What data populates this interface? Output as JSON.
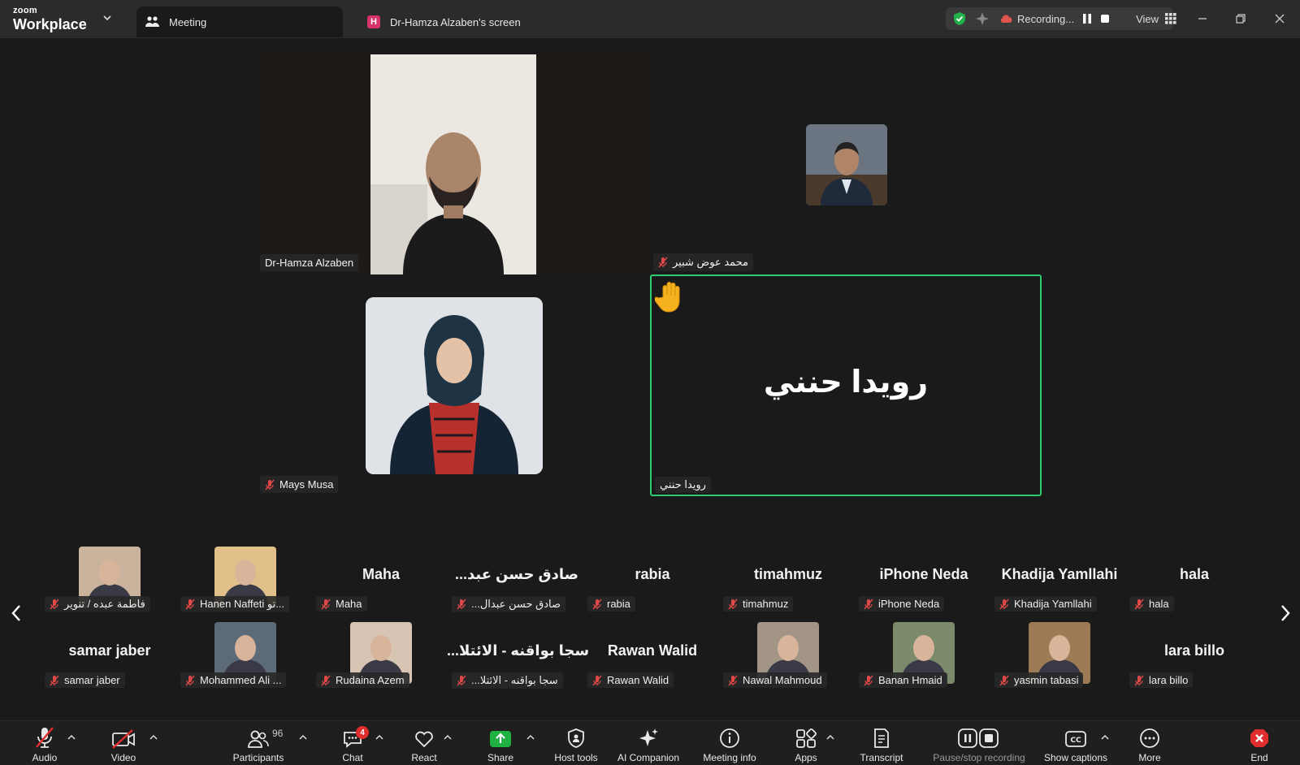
{
  "app": {
    "brand_small": "zoom",
    "brand_large": "Workplace"
  },
  "tabs": [
    {
      "label": "Meeting",
      "active": true
    },
    {
      "label": "Dr-Hamza Alzaben's screen",
      "badge": "H",
      "active": false
    }
  ],
  "recording": {
    "label": "Recording...",
    "view_label": "View"
  },
  "main_tiles": [
    {
      "name": "Dr-Hamza Alzaben",
      "muted": false
    },
    {
      "name": "محمد عوض شبير",
      "muted": true
    },
    {
      "name": "Mays Musa",
      "muted": true
    },
    {
      "name": "رويدا حنني",
      "muted": true,
      "display_name": "رويدا حنني",
      "raised_hand": true,
      "active_speaker_color": "#2ecc71"
    }
  ],
  "gallery": {
    "row1": [
      {
        "label": "فاطمة عبده / تنوير",
        "has_photo": true
      },
      {
        "label": "Hanen Naffeti تو...",
        "has_photo": true
      },
      {
        "label": "Maha",
        "big": "Maha"
      },
      {
        "label": "...صادق حسن عبدال",
        "big": "...صادق حسن عبد"
      },
      {
        "label": "rabia",
        "big": "rabia"
      },
      {
        "label": "timahmuz",
        "big": "timahmuz"
      },
      {
        "label": "iPhone Neda",
        "big": "iPhone Neda"
      },
      {
        "label": "Khadija Yamllahi",
        "big": "Khadija Yamllahi"
      },
      {
        "label": "hala",
        "big": "hala"
      }
    ],
    "row2": [
      {
        "label": "samar jaber",
        "big": "samar jaber"
      },
      {
        "label": "Mohammed Ali ...",
        "has_photo": true
      },
      {
        "label": "Rudaina Azem",
        "has_photo": true
      },
      {
        "label": "...سجا بواقنه - الائتلا",
        "big": "...سجا بواقنه - الائتلا"
      },
      {
        "label": "Rawan Walid",
        "big": "Rawan Walid"
      },
      {
        "label": "Nawal Mahmoud",
        "has_photo": true
      },
      {
        "label": "Banan Hmaid",
        "has_photo": true
      },
      {
        "label": "yasmin tabasi",
        "has_photo": true
      },
      {
        "label": "lara billo",
        "big": "lara billo"
      }
    ]
  },
  "toolbar": {
    "audio": "Audio",
    "video": "Video",
    "participants": "Participants",
    "participants_count": "96",
    "chat": "Chat",
    "chat_badge": "4",
    "react": "React",
    "share": "Share",
    "host_tools": "Host tools",
    "ai_companion": "AI Companion",
    "meeting_info": "Meeting info",
    "apps": "Apps",
    "transcript": "Transcript",
    "pause_stop": "Pause/stop recording",
    "show_captions": "Show captions",
    "more": "More",
    "end": "End"
  },
  "colors": {
    "share_green": "#1fb141",
    "end_red": "#e02d2d",
    "active_border": "#2ecc71"
  }
}
